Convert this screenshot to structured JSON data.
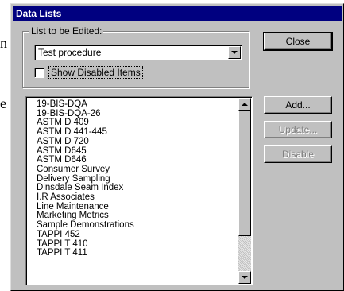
{
  "background_text": {
    "left_edge": "n",
    "left_edge_2": "e"
  },
  "dialog": {
    "title": "Data Lists",
    "group_label": "List to be Edited:",
    "combo_value": "Test procedure",
    "show_disabled_label": "Show Disabled Items",
    "show_disabled_checked": false,
    "buttons": {
      "close": "Close",
      "add": "Add...",
      "update": "Update...",
      "disable": "Disable"
    },
    "list_items": [
      "19-BIS-DQA",
      "19-BIS-DQA-26",
      "ASTM D 409",
      "ASTM D 441-445",
      "ASTM D 720",
      "ASTM D645",
      "ASTM D646",
      "Consumer Survey",
      "Delivery Sampling",
      "Dinsdale Seam Index",
      "I.R Associates",
      "Line Maintenance",
      "Marketing Metrics",
      "Sample Demonstrations",
      "TAPPI 452",
      "TAPPI T 410",
      "TAPPI T 411"
    ]
  }
}
